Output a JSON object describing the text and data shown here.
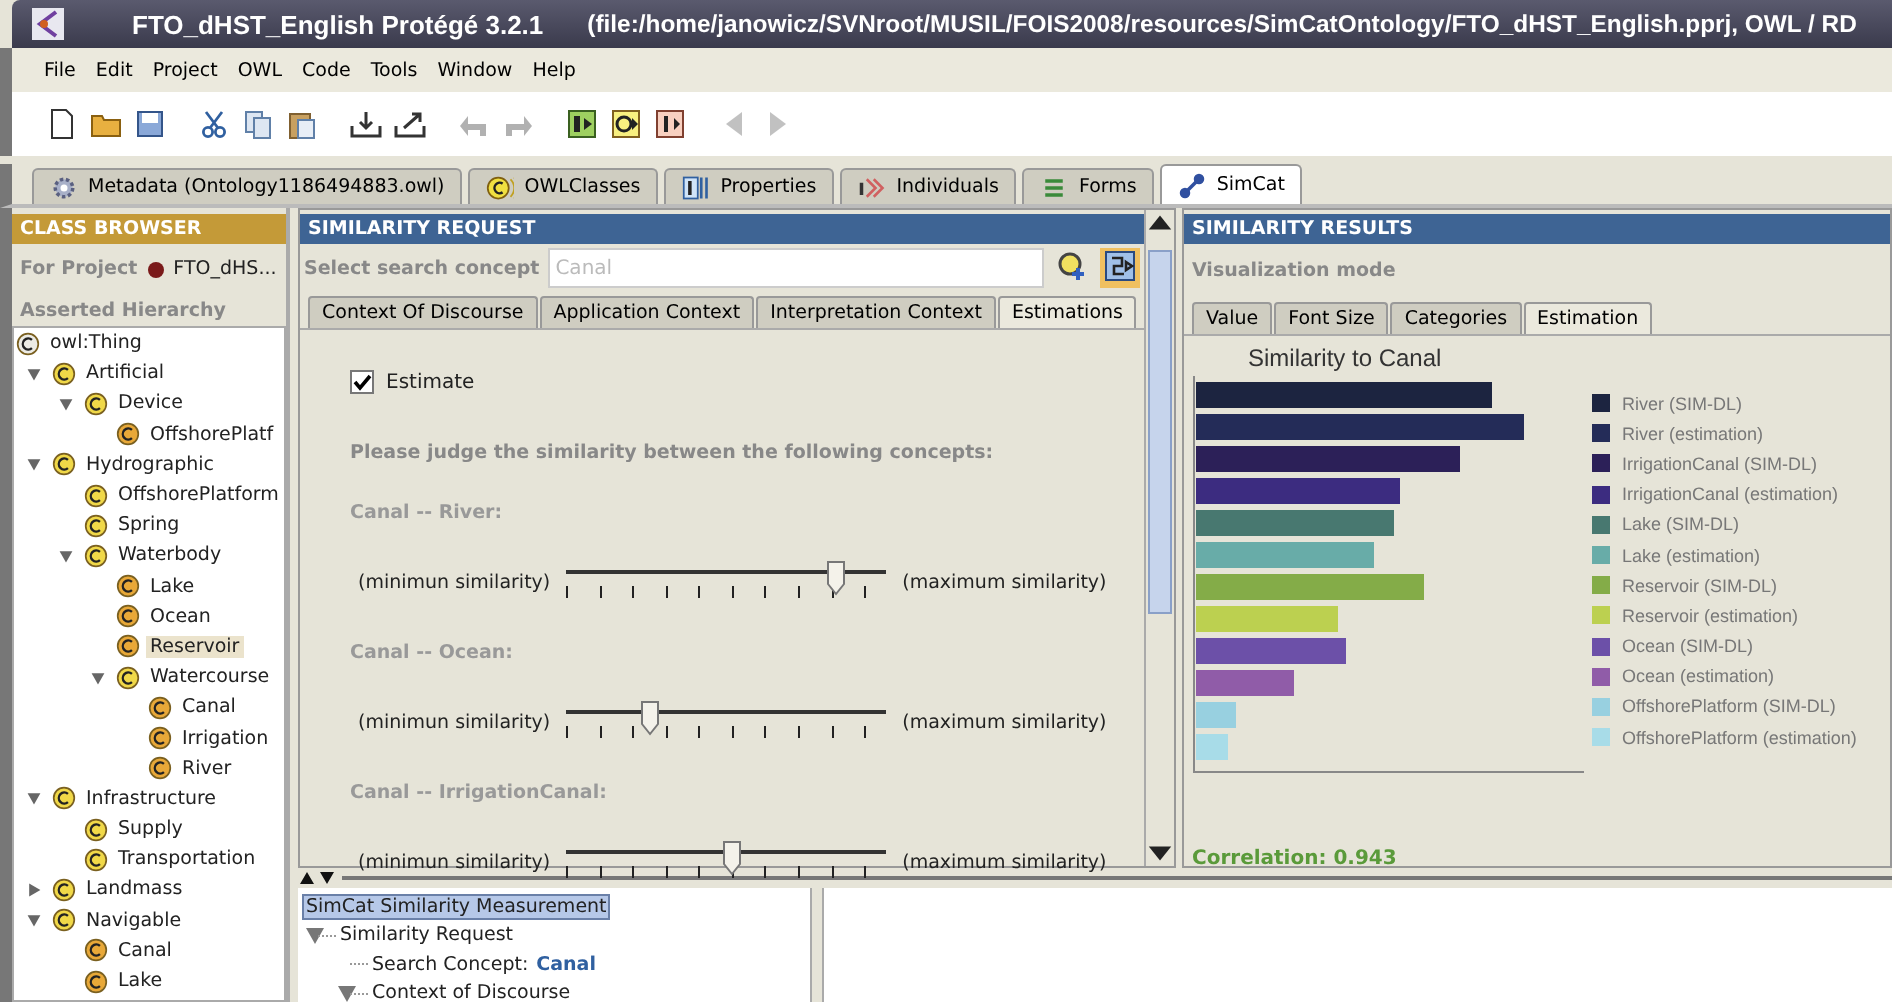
{
  "window": {
    "title": "FTO_dHST_English  Protégé 3.2.1",
    "path": "(file:/home/janowicz/SVNroot/MUSIL/FOIS2008/resources/SimCatOntology/FTO_dHST_English.pprj, OWL / RD"
  },
  "menu": [
    "File",
    "Edit",
    "Project",
    "OWL",
    "Code",
    "Tools",
    "Window",
    "Help"
  ],
  "toolbar": [
    {
      "disabled": false
    },
    {
      "disabled": false
    },
    {
      "disabled": false
    },
    {
      "disabled": false
    },
    {
      "disabled": false
    },
    {
      "disabled": false
    },
    {
      "disabled": false
    },
    {
      "disabled": false
    },
    {
      "disabled": true
    },
    {
      "disabled": true
    },
    {
      "disabled": false
    },
    {
      "disabled": false
    },
    {
      "disabled": false
    },
    {
      "disabled": true
    },
    {
      "disabled": true
    }
  ],
  "tabs": [
    {
      "label": "Metadata (Ontology1186494883.owl)",
      "selected": false
    },
    {
      "label": "OWLClasses",
      "selected": false
    },
    {
      "label": "Properties",
      "selected": false
    },
    {
      "label": "Individuals",
      "selected": false
    },
    {
      "label": "Forms",
      "selected": false
    },
    {
      "label": "SimCat",
      "selected": true
    }
  ],
  "class_browser": {
    "title": "CLASS BROWSER",
    "project_label": "For Project",
    "project": "FTO_dHS...",
    "hierarchy_label": "Asserted Hierarchy",
    "tree": {
      "label": "owl:Thing",
      "color": "#ecebe4",
      "selected": false,
      "children": [
        {
          "label": "Artificial",
          "color": "#f0d848",
          "selected": false,
          "expanded": true,
          "children": [
            {
              "label": "Device",
              "color": "#f0d848",
              "selected": false,
              "expanded": true,
              "children": [
                {
                  "label": "OffshorePlatf",
                  "color": "#e8a838",
                  "selected": false
                }
              ]
            }
          ]
        },
        {
          "label": "Hydrographic",
          "color": "#f0d848",
          "selected": false,
          "expanded": true,
          "children": [
            {
              "label": "OffshorePlatform",
              "color": "#f0d848",
              "selected": false
            },
            {
              "label": "Spring",
              "color": "#f0d848",
              "selected": false
            },
            {
              "label": "Waterbody",
              "color": "#f0d848",
              "selected": false,
              "expanded": true,
              "children": [
                {
                  "label": "Lake",
                  "color": "#e8a838",
                  "selected": false
                },
                {
                  "label": "Ocean",
                  "color": "#e8a838",
                  "selected": false
                },
                {
                  "label": "Reservoir",
                  "color": "#e8a838",
                  "selected": true
                },
                {
                  "label": "Watercourse",
                  "color": "#f0d848",
                  "selected": false,
                  "expanded": true,
                  "children": [
                    {
                      "label": "Canal",
                      "color": "#e8a838",
                      "selected": false
                    },
                    {
                      "label": "Irrigation",
                      "color": "#e8a838",
                      "selected": false
                    },
                    {
                      "label": "River",
                      "color": "#e8a838",
                      "selected": false
                    }
                  ]
                }
              ]
            }
          ]
        },
        {
          "label": "Infrastructure",
          "color": "#f0d848",
          "selected": false,
          "expanded": true,
          "children": [
            {
              "label": "Supply",
              "color": "#f0d848",
              "selected": false
            },
            {
              "label": "Transportation",
              "color": "#f0d848",
              "selected": false
            }
          ]
        },
        {
          "label": "Landmass",
          "color": "#f0d848",
          "selected": false,
          "expanded": false
        },
        {
          "label": "Navigable",
          "color": "#f0d848",
          "selected": false,
          "expanded": true,
          "children": [
            {
              "label": "Canal",
              "color": "#e8a838",
              "selected": false
            },
            {
              "label": "Lake",
              "color": "#e8a838",
              "selected": false
            }
          ]
        }
      ]
    }
  },
  "request": {
    "title": "SIMILARITY REQUEST",
    "search_label": "Select search concept",
    "search_placeholder": "Canal",
    "tabs": [
      {
        "label": "Context Of Discourse",
        "selected": false
      },
      {
        "label": "Application Context",
        "selected": false
      },
      {
        "label": "Interpretation Context",
        "selected": false
      },
      {
        "label": "Estimations",
        "selected": true
      }
    ],
    "estimate": {
      "label": "Estimate",
      "checked": true
    },
    "instruction": "Please judge the similarity between the following concepts:",
    "comparisons": [
      {
        "label": "Canal -- River:",
        "min_label": "(minimun similarity)",
        "max_label": "(maximum similarity)",
        "level": 0.84
      },
      {
        "label": "Canal -- Ocean:",
        "min_label": "(minimun similarity)",
        "max_label": "(maximum similarity)",
        "level": 0.26
      },
      {
        "label": "Canal -- IrrigationCanal:",
        "min_label": "(minimun similarity)",
        "max_label": "(maximum similarity)",
        "level": 0.52
      }
    ]
  },
  "results": {
    "title": "SIMILARITY RESULTS",
    "mode_label": "Visualization mode",
    "tabs": [
      {
        "label": "Value",
        "selected": false
      },
      {
        "label": "Font Size",
        "selected": false
      },
      {
        "label": "Categories",
        "selected": false
      },
      {
        "label": "Estimation",
        "selected": true
      }
    ],
    "chart_title": "Similarity to Canal",
    "legend": [
      {
        "label": "River (SIM-DL)",
        "color": "#1c2440"
      },
      {
        "label": "River (estimation)",
        "color": "#242c58"
      },
      {
        "label": "IrrigationCanal (SIM-DL)",
        "color": "#2c2058"
      },
      {
        "label": "IrrigationCanal (estimation)",
        "color": "#3c2c80"
      },
      {
        "label": "Lake (SIM-DL)",
        "color": "#487870"
      },
      {
        "label": "Lake (estimation)",
        "color": "#68aca8"
      },
      {
        "label": "Reservoir (SIM-DL)",
        "color": "#84ac48"
      },
      {
        "label": "Reservoir (estimation)",
        "color": "#bcd050"
      },
      {
        "label": "Ocean (SIM-DL)",
        "color": "#6c50a8"
      },
      {
        "label": "Ocean (estimation)",
        "color": "#905ca8"
      },
      {
        "label": "OffshorePlatform (SIM-DL)",
        "color": "#98d0e0"
      },
      {
        "label": "OffshorePlatform (estimation)",
        "color": "#a8dce8"
      }
    ],
    "correlation": "Correlation: 0.943"
  },
  "measurement_tree": [
    {
      "label": "SimCat Similarity Measurement",
      "selected": true,
      "children": [
        {
          "label": "Similarity Request",
          "selected": false,
          "expanded": true,
          "children": [
            {
              "label": "Search Concept:",
              "value": "Canal",
              "selected": false
            },
            {
              "label": "Context of Discourse",
              "selected": false,
              "expanded": true
            }
          ]
        }
      ]
    }
  ]
}
